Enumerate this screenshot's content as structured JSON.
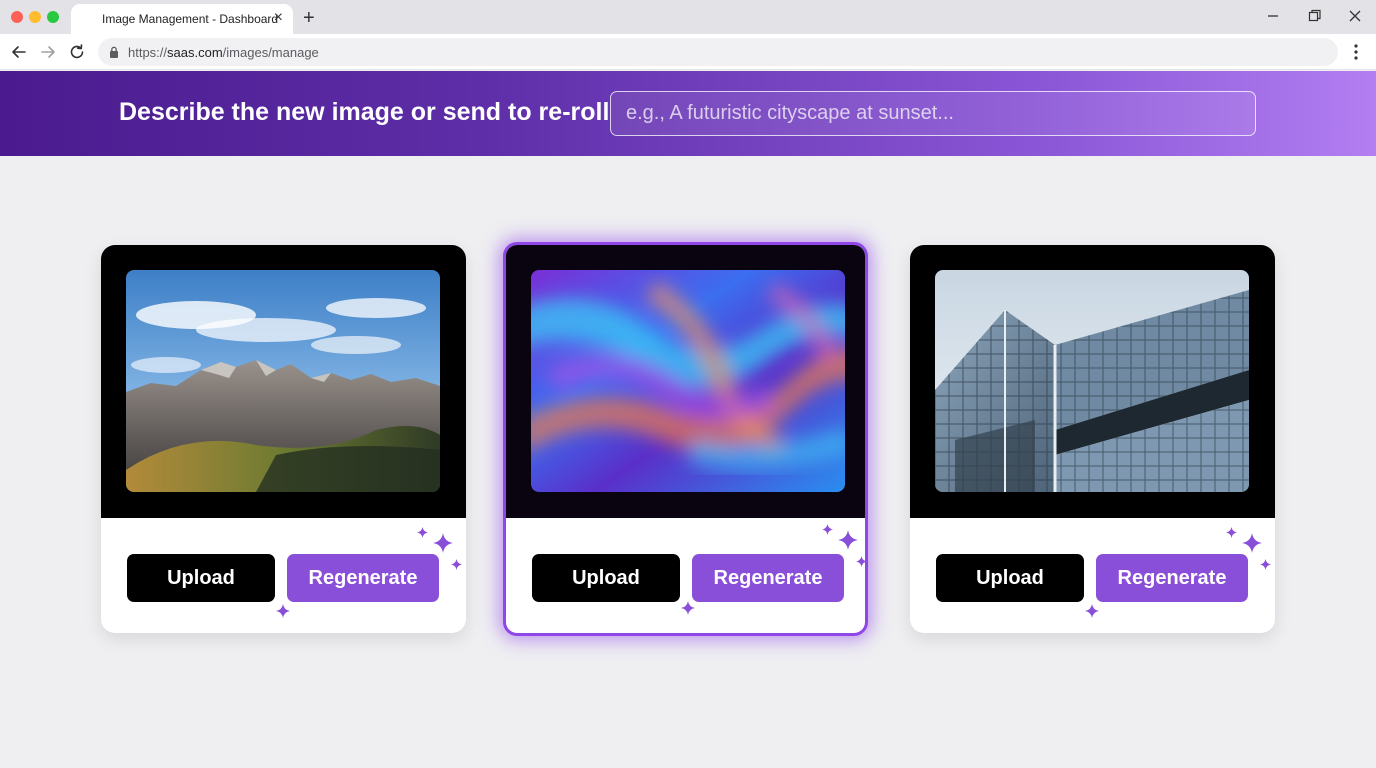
{
  "browser": {
    "tab_title": "Image Management - Dashboard",
    "tab_close": "×",
    "new_tab": "+",
    "url_prefix": "https://",
    "url_domain": "saas.com",
    "url_path": "/images/manage"
  },
  "banner": {
    "title": "Describe the new image or send to re-roll",
    "input_value": "",
    "input_placeholder": "e.g., A futuristic cityscape at sunset..."
  },
  "cards": [
    {
      "image": "mountain-landscape",
      "upload_label": "Upload",
      "regenerate_label": "Regenerate",
      "selected": false
    },
    {
      "image": "abstract-fluid-gradient",
      "upload_label": "Upload",
      "regenerate_label": "Regenerate",
      "selected": true
    },
    {
      "image": "glass-office-building",
      "upload_label": "Upload",
      "regenerate_label": "Regenerate",
      "selected": false
    }
  ],
  "colors": {
    "accent": "#8a4fd8",
    "selected_border": "#8f47e8",
    "banner_start": "#4a1a8e",
    "banner_end": "#b27ef1",
    "upload_button": "#000000"
  },
  "icons": [
    "sparkle-icon",
    "lock-icon",
    "back-arrow-icon",
    "forward-arrow-icon",
    "reload-icon",
    "more-vert-icon"
  ]
}
